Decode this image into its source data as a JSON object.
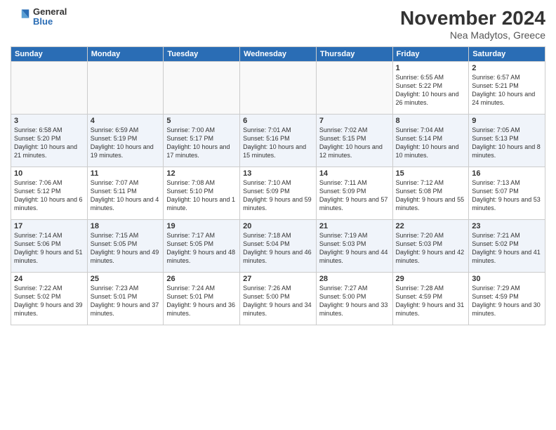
{
  "logo": {
    "general": "General",
    "blue": "Blue"
  },
  "header": {
    "month": "November 2024",
    "location": "Nea Madytos, Greece"
  },
  "weekdays": [
    "Sunday",
    "Monday",
    "Tuesday",
    "Wednesday",
    "Thursday",
    "Friday",
    "Saturday"
  ],
  "weeks": [
    [
      {
        "day": "",
        "info": ""
      },
      {
        "day": "",
        "info": ""
      },
      {
        "day": "",
        "info": ""
      },
      {
        "day": "",
        "info": ""
      },
      {
        "day": "",
        "info": ""
      },
      {
        "day": "1",
        "info": "Sunrise: 6:55 AM\nSunset: 5:22 PM\nDaylight: 10 hours and 26 minutes."
      },
      {
        "day": "2",
        "info": "Sunrise: 6:57 AM\nSunset: 5:21 PM\nDaylight: 10 hours and 24 minutes."
      }
    ],
    [
      {
        "day": "3",
        "info": "Sunrise: 6:58 AM\nSunset: 5:20 PM\nDaylight: 10 hours and 21 minutes."
      },
      {
        "day": "4",
        "info": "Sunrise: 6:59 AM\nSunset: 5:19 PM\nDaylight: 10 hours and 19 minutes."
      },
      {
        "day": "5",
        "info": "Sunrise: 7:00 AM\nSunset: 5:17 PM\nDaylight: 10 hours and 17 minutes."
      },
      {
        "day": "6",
        "info": "Sunrise: 7:01 AM\nSunset: 5:16 PM\nDaylight: 10 hours and 15 minutes."
      },
      {
        "day": "7",
        "info": "Sunrise: 7:02 AM\nSunset: 5:15 PM\nDaylight: 10 hours and 12 minutes."
      },
      {
        "day": "8",
        "info": "Sunrise: 7:04 AM\nSunset: 5:14 PM\nDaylight: 10 hours and 10 minutes."
      },
      {
        "day": "9",
        "info": "Sunrise: 7:05 AM\nSunset: 5:13 PM\nDaylight: 10 hours and 8 minutes."
      }
    ],
    [
      {
        "day": "10",
        "info": "Sunrise: 7:06 AM\nSunset: 5:12 PM\nDaylight: 10 hours and 6 minutes."
      },
      {
        "day": "11",
        "info": "Sunrise: 7:07 AM\nSunset: 5:11 PM\nDaylight: 10 hours and 4 minutes."
      },
      {
        "day": "12",
        "info": "Sunrise: 7:08 AM\nSunset: 5:10 PM\nDaylight: 10 hours and 1 minute."
      },
      {
        "day": "13",
        "info": "Sunrise: 7:10 AM\nSunset: 5:09 PM\nDaylight: 9 hours and 59 minutes."
      },
      {
        "day": "14",
        "info": "Sunrise: 7:11 AM\nSunset: 5:09 PM\nDaylight: 9 hours and 57 minutes."
      },
      {
        "day": "15",
        "info": "Sunrise: 7:12 AM\nSunset: 5:08 PM\nDaylight: 9 hours and 55 minutes."
      },
      {
        "day": "16",
        "info": "Sunrise: 7:13 AM\nSunset: 5:07 PM\nDaylight: 9 hours and 53 minutes."
      }
    ],
    [
      {
        "day": "17",
        "info": "Sunrise: 7:14 AM\nSunset: 5:06 PM\nDaylight: 9 hours and 51 minutes."
      },
      {
        "day": "18",
        "info": "Sunrise: 7:15 AM\nSunset: 5:05 PM\nDaylight: 9 hours and 49 minutes."
      },
      {
        "day": "19",
        "info": "Sunrise: 7:17 AM\nSunset: 5:05 PM\nDaylight: 9 hours and 48 minutes."
      },
      {
        "day": "20",
        "info": "Sunrise: 7:18 AM\nSunset: 5:04 PM\nDaylight: 9 hours and 46 minutes."
      },
      {
        "day": "21",
        "info": "Sunrise: 7:19 AM\nSunset: 5:03 PM\nDaylight: 9 hours and 44 minutes."
      },
      {
        "day": "22",
        "info": "Sunrise: 7:20 AM\nSunset: 5:03 PM\nDaylight: 9 hours and 42 minutes."
      },
      {
        "day": "23",
        "info": "Sunrise: 7:21 AM\nSunset: 5:02 PM\nDaylight: 9 hours and 41 minutes."
      }
    ],
    [
      {
        "day": "24",
        "info": "Sunrise: 7:22 AM\nSunset: 5:02 PM\nDaylight: 9 hours and 39 minutes."
      },
      {
        "day": "25",
        "info": "Sunrise: 7:23 AM\nSunset: 5:01 PM\nDaylight: 9 hours and 37 minutes."
      },
      {
        "day": "26",
        "info": "Sunrise: 7:24 AM\nSunset: 5:01 PM\nDaylight: 9 hours and 36 minutes."
      },
      {
        "day": "27",
        "info": "Sunrise: 7:26 AM\nSunset: 5:00 PM\nDaylight: 9 hours and 34 minutes."
      },
      {
        "day": "28",
        "info": "Sunrise: 7:27 AM\nSunset: 5:00 PM\nDaylight: 9 hours and 33 minutes."
      },
      {
        "day": "29",
        "info": "Sunrise: 7:28 AM\nSunset: 4:59 PM\nDaylight: 9 hours and 31 minutes."
      },
      {
        "day": "30",
        "info": "Sunrise: 7:29 AM\nSunset: 4:59 PM\nDaylight: 9 hours and 30 minutes."
      }
    ]
  ]
}
